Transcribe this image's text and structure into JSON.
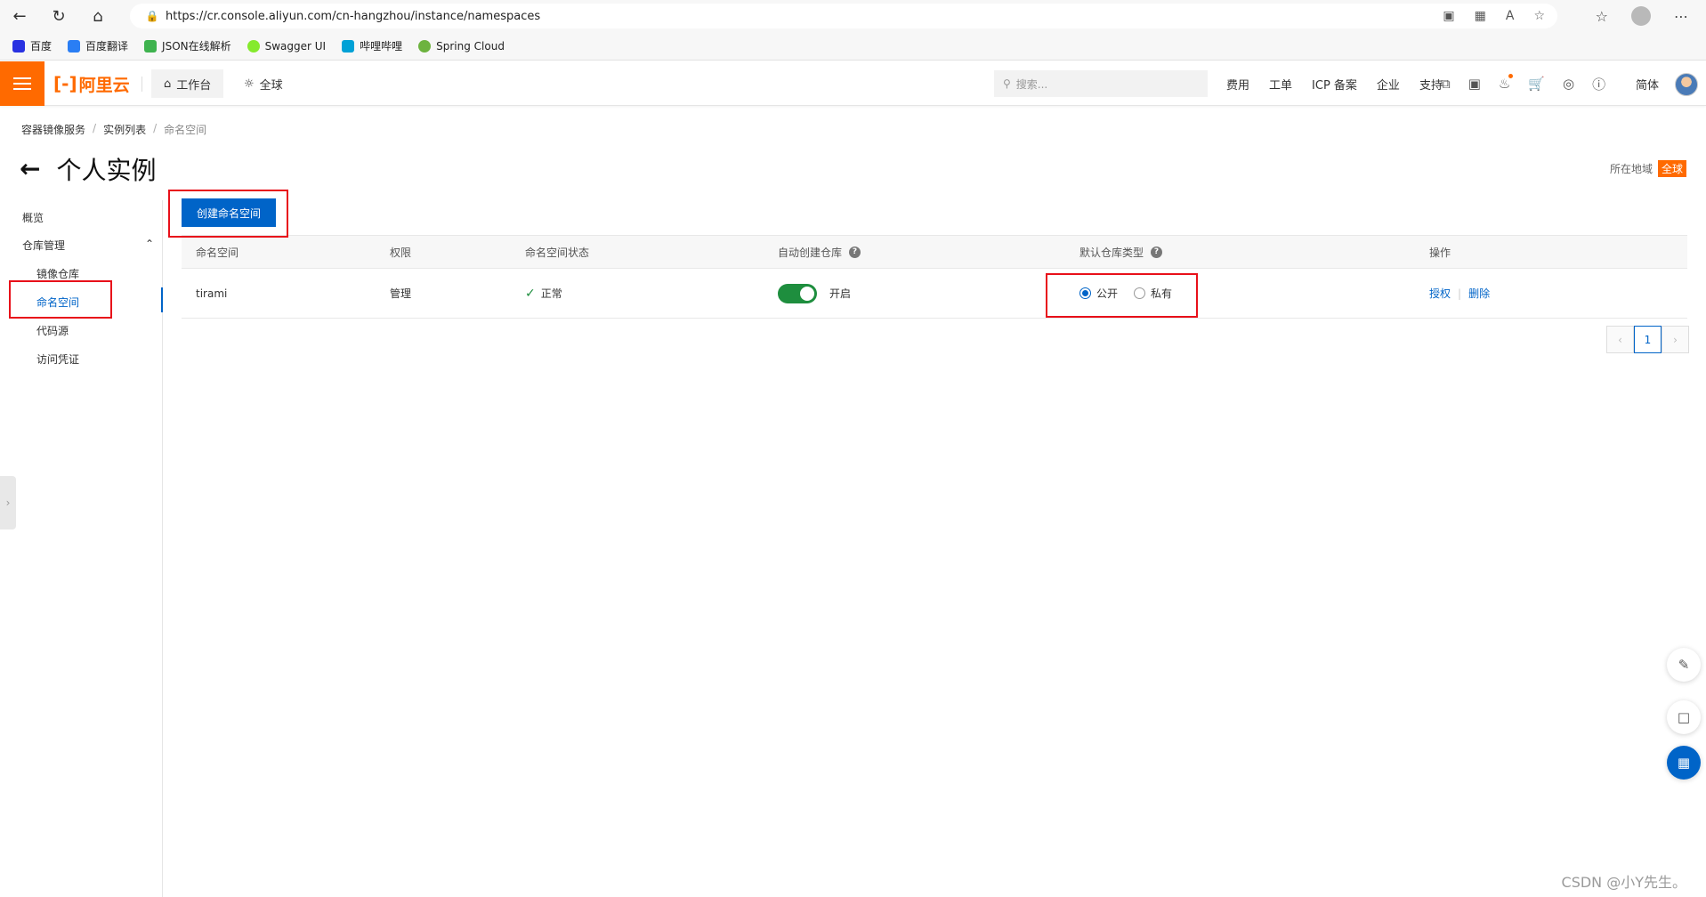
{
  "browser": {
    "url": "https://cr.console.aliyun.com/cn-hangzhou/instance/namespaces",
    "bookmarks": [
      {
        "label": "百度",
        "icon": "baidu-icon",
        "color": "#2932e1"
      },
      {
        "label": "百度翻译",
        "icon": "translate-icon",
        "color": "#2a7ef4"
      },
      {
        "label": "JSON在线解析",
        "icon": "json-icon",
        "color": "#3fb34f"
      },
      {
        "label": "Swagger UI",
        "icon": "swagger-icon",
        "color": "#85ea2d"
      },
      {
        "label": "哔哩哔哩",
        "icon": "bilibili-icon",
        "color": "#00a1d6"
      },
      {
        "label": "Spring Cloud",
        "icon": "spring-icon",
        "color": "#6db33f"
      }
    ]
  },
  "console": {
    "logo": "阿里云",
    "workbench_label": "工作台",
    "region_label": "全球",
    "search_placeholder": "搜索...",
    "top_links": [
      "费用",
      "工单",
      "ICP 备案",
      "企业",
      "支持"
    ],
    "language": "简体",
    "brand_color": "#ff6a00"
  },
  "page": {
    "breadcrumb": [
      "容器镜像服务",
      "实例列表",
      "命名空间"
    ],
    "title": "个人实例",
    "region_label": "所在地域",
    "region_value": "全球"
  },
  "sidenav": {
    "overview": "概览",
    "group_label": "仓库管理",
    "items": [
      "镜像仓库",
      "命名空间",
      "代码源",
      "访问凭证"
    ],
    "active_index": 1
  },
  "main": {
    "create_button": "创建命名空间",
    "columns": [
      "命名空间",
      "权限",
      "命名空间状态",
      "自动创建仓库",
      "默认仓库类型",
      "操作"
    ],
    "rows": [
      {
        "namespace": "tirami",
        "permission": "管理",
        "status": "正常",
        "auto_create": true,
        "auto_create_label": "开启",
        "repo_type_options": [
          "公开",
          "私有"
        ],
        "repo_type_selected": "公开",
        "actions": [
          "授权",
          "删除"
        ]
      }
    ],
    "pagination": {
      "current_page": "1"
    }
  },
  "watermark": "CSDN @小Y先生。",
  "accent_color": "#0064c8"
}
